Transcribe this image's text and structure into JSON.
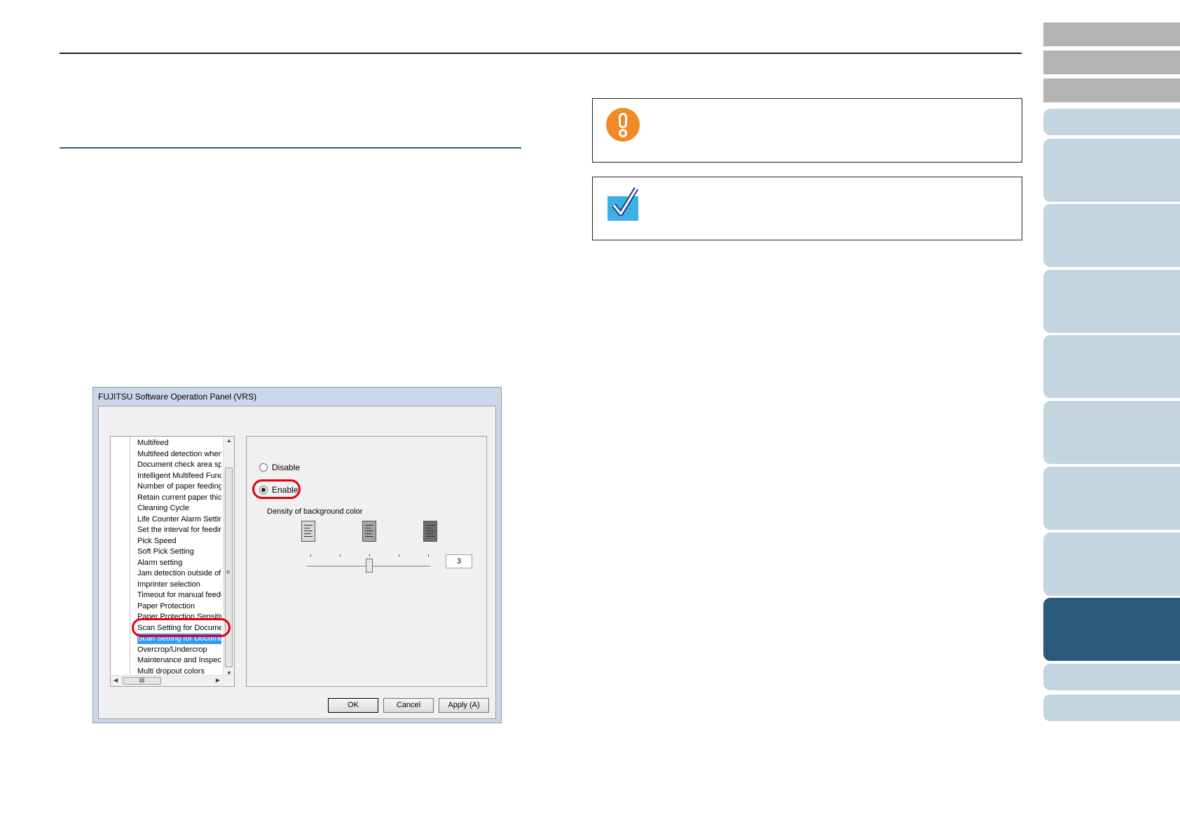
{
  "page": {
    "colors": {
      "rule": "#231f20",
      "accent": "#2b5b7a",
      "highlight": "#e3000b"
    }
  },
  "notes": [
    {
      "kind": "important",
      "icon": "exclamation-icon",
      "text": ""
    },
    {
      "kind": "hint",
      "icon": "checkmark-icon",
      "text": ""
    }
  ],
  "nav_tabs": [
    {
      "label": "",
      "style": "gray"
    },
    {
      "label": "",
      "style": "gray"
    },
    {
      "label": "",
      "style": "gray"
    },
    {
      "label": "",
      "style": "light"
    },
    {
      "label": "",
      "style": "light"
    },
    {
      "label": "",
      "style": "light"
    },
    {
      "label": "",
      "style": "light"
    },
    {
      "label": "",
      "style": "light"
    },
    {
      "label": "",
      "style": "light"
    },
    {
      "label": "",
      "style": "light"
    },
    {
      "label": "",
      "style": "light"
    },
    {
      "label": "",
      "style": "active"
    },
    {
      "label": "",
      "style": "light"
    },
    {
      "label": "",
      "style": "light"
    }
  ],
  "dialog": {
    "title": "FUJITSU Software Operation Panel (VRS)",
    "tree_items": [
      "Multifeed",
      "Multifeed detection when s",
      "Document check area spe",
      "Intelligent Multifeed Functio",
      "Number of paper feeding re",
      "Retain current paper thickn",
      "Cleaning Cycle",
      "Life Counter Alarm Setting",
      "Set the interval for feeding",
      "Pick Speed",
      "Soft Pick Setting",
      "Alarm setting",
      "Jam detection outside of sc",
      "Imprinter selection",
      "Timeout for manual feeding",
      "Paper Protection",
      "Paper Protection Sensitivity",
      "Scan Setting for Document",
      "Scan Setting for Document",
      "Overcrop/Undercrop",
      "Maintenance and Inspectio",
      "Multi dropout colors"
    ],
    "selected_index": 18,
    "hscroll_label": "III",
    "radio_disable": "Disable",
    "radio_enable": "Enable",
    "enable_checked": true,
    "density_label": "Density of background color",
    "slider_value": "3",
    "buttons": {
      "ok": "OK",
      "cancel": "Cancel",
      "apply": "Apply (A)"
    }
  }
}
